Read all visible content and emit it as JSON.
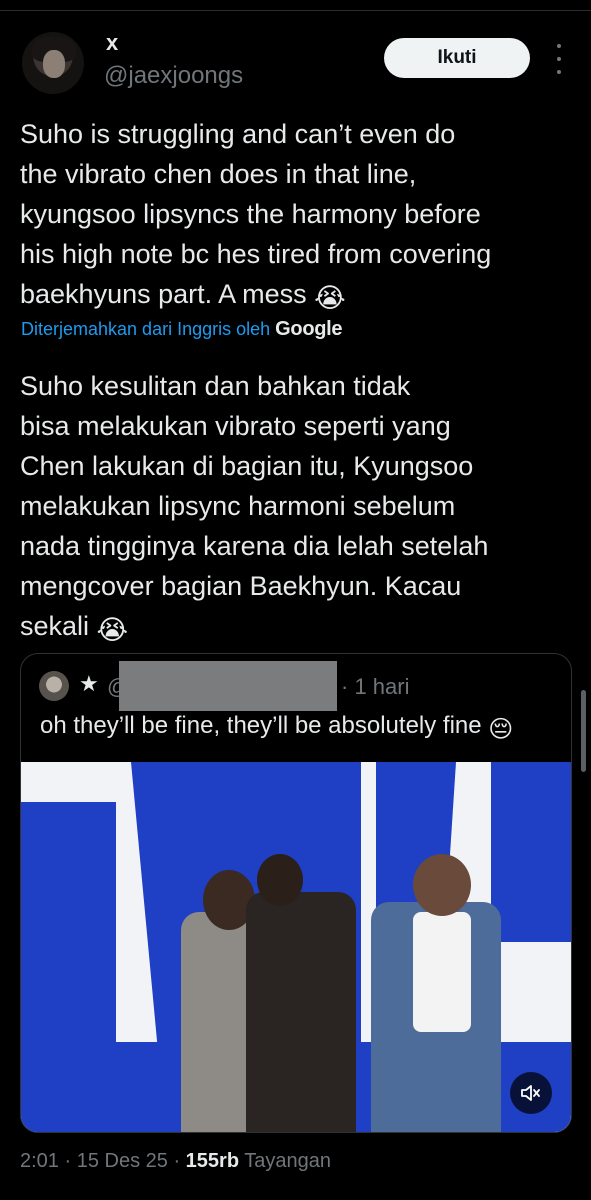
{
  "author": {
    "display_name": "x",
    "handle": "@jaexjoongs",
    "follow_label": "Ikuti"
  },
  "tweet": {
    "text": "Suho is struggling and can’t even do\nthe vibrato chen does in that line,\nkyungsoo lipsyncs the harmony before\nhis high note bc hes tired from covering\nbaekhyuns part. A mess ",
    "emoji": "😭",
    "translation_credit": "Diterjemahkan dari Inggris oleh",
    "translation_brand": "Google",
    "translated_text": "Suho kesulitan dan bahkan tidak\nbisa melakukan vibrato seperti yang\nChen lakukan di bagian itu, Kyungsoo\nmelakukan lipsync harmoni sebelum\nnada tingginya karena dia lelah setelah\nmengcover bagian Baekhyun. Kacau\nsekali ",
    "translated_emoji": "😭"
  },
  "quote": {
    "handle_start": "@",
    "time": "· 1 hari",
    "text": "oh they’ll be fine, they’ll be absolutely fine ",
    "emoji": "😔"
  },
  "meta": {
    "time": "2:01",
    "date": "15 Des 25",
    "views_count": "155rb",
    "views_label": "Tayangan"
  },
  "colors": {
    "background": "#000000",
    "text": "#e7e9ea",
    "secondary": "#71767b",
    "link": "#1d9bf0",
    "stage_blue": "#1f3fc4"
  }
}
